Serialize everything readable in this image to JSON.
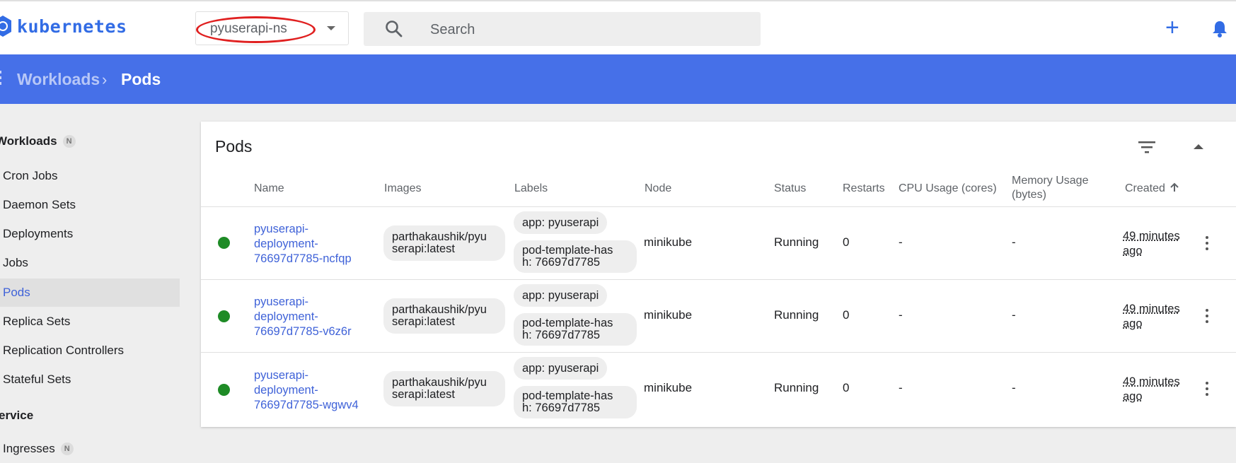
{
  "app": {
    "logo_text": "kubernetes",
    "brand_color": "#326ce5",
    "accent_bar_color": "#4670e8"
  },
  "namespace": {
    "value": "pyuserapi-ns",
    "annotation_color": "#e02020"
  },
  "search": {
    "placeholder": "Search"
  },
  "breadcrumb": {
    "parent": "Workloads",
    "current": "Pods"
  },
  "sidebar": {
    "workloads_heading": "Workloads",
    "workloads_badge": "N",
    "items": [
      {
        "label": "Cron Jobs"
      },
      {
        "label": "Daemon Sets"
      },
      {
        "label": "Deployments"
      },
      {
        "label": "Jobs"
      },
      {
        "label": "Pods",
        "active": true
      },
      {
        "label": "Replica Sets"
      },
      {
        "label": "Replication Controllers"
      },
      {
        "label": "Stateful Sets"
      }
    ],
    "service_heading": "ervice",
    "ingresses_label": "Ingresses",
    "ingresses_badge": "N"
  },
  "pods": {
    "title": "Pods",
    "columns": {
      "name": "Name",
      "images": "Images",
      "labels": "Labels",
      "node": "Node",
      "status": "Status",
      "restarts": "Restarts",
      "cpu": "CPU Usage (cores)",
      "memory_line1": "Memory Usage",
      "memory_line2": "(bytes)",
      "created": "Created"
    },
    "rows": [
      {
        "name_l1": "pyuserapi-",
        "name_l2": "deployment-",
        "name_l3": "76697d7785-ncfqp",
        "image_l1": "parthakaushik/pyu",
        "image_l2": "serapi:latest",
        "label1": "app: pyuserapi",
        "label2_l1": "pod-template-has",
        "label2_l2": "h: 76697d7785",
        "node": "minikube",
        "status": "Running",
        "restarts": "0",
        "cpu": "-",
        "memory": "-",
        "created_l1": "49 minutes",
        "created_l2": "ago"
      },
      {
        "name_l1": "pyuserapi-",
        "name_l2": "deployment-",
        "name_l3": "76697d7785-v6z6r",
        "image_l1": "parthakaushik/pyu",
        "image_l2": "serapi:latest",
        "label1": "app: pyuserapi",
        "label2_l1": "pod-template-has",
        "label2_l2": "h: 76697d7785",
        "node": "minikube",
        "status": "Running",
        "restarts": "0",
        "cpu": "-",
        "memory": "-",
        "created_l1": "49 minutes",
        "created_l2": "ago"
      },
      {
        "name_l1": "pyuserapi-",
        "name_l2": "deployment-",
        "name_l3": "76697d7785-wgwv4",
        "image_l1": "parthakaushik/pyu",
        "image_l2": "serapi:latest",
        "label1": "app: pyuserapi",
        "label2_l1": "pod-template-has",
        "label2_l2": "h: 76697d7785",
        "node": "minikube",
        "status": "Running",
        "restarts": "0",
        "cpu": "-",
        "memory": "-",
        "created_l1": "49 minutes",
        "created_l2": "ago"
      }
    ]
  }
}
